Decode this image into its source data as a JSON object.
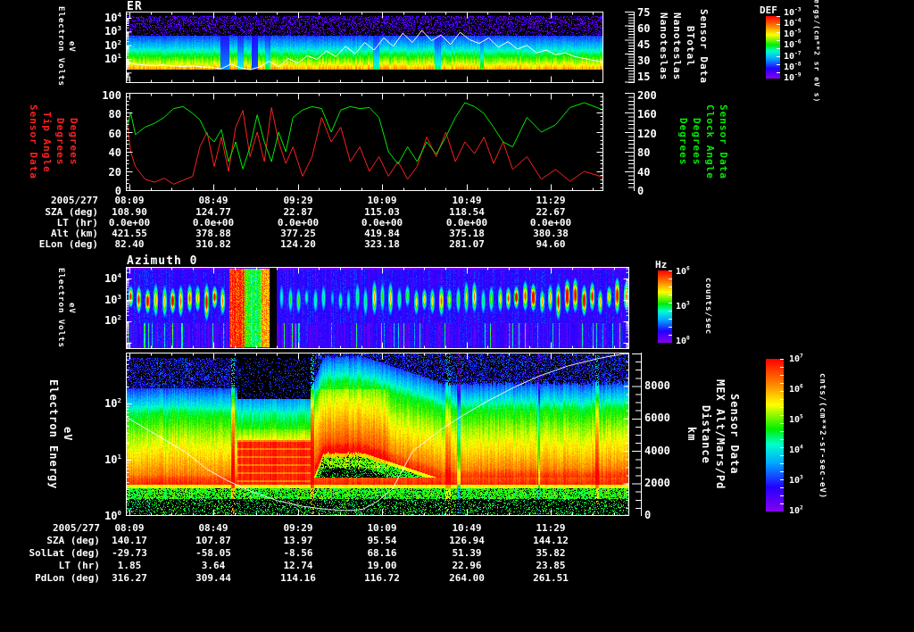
{
  "colors": {
    "background": "#000000",
    "axis": "#ffffff",
    "tip_series": "#ff2020",
    "clock_series": "#00ee00",
    "overlay_line": "#ffffff",
    "palette": [
      {
        "t": 0.0,
        "c": "#8800ee"
      },
      {
        "t": 0.16,
        "c": "#2200ff"
      },
      {
        "t": 0.32,
        "c": "#00aaff"
      },
      {
        "t": 0.44,
        "c": "#00ffcc"
      },
      {
        "t": 0.54,
        "c": "#00ee00"
      },
      {
        "t": 0.7,
        "c": "#ffff00"
      },
      {
        "t": 0.83,
        "c": "#ff8800"
      },
      {
        "t": 1.0,
        "c": "#ff0000"
      }
    ]
  },
  "er": {
    "title": "ER",
    "ylabel_lines": [
      "Electron Volts",
      "eV"
    ],
    "yticks": [
      "10^4",
      "10^3",
      "10^2",
      "10^1"
    ],
    "right_ticks": [
      "75",
      "60",
      "45",
      "30",
      "15"
    ],
    "right_label_lines": [
      "Sensor Data",
      "BTotal",
      "Nanoteslas",
      "Nanoteslas"
    ],
    "colorbar": {
      "title": "DEF",
      "ticks": [
        "10^-3",
        "10^-4",
        "10^-5",
        "10^-6",
        "10^-7",
        "10^-8",
        "10^-9"
      ],
      "units": "ergs/(cm**2 sr eV s)"
    }
  },
  "angles": {
    "left_label_lines": [
      "Sensor Data",
      "Tip Angle",
      "Degrees",
      "Degrees"
    ],
    "left_ticks": [
      "100",
      "80",
      "60",
      "40",
      "20",
      "0"
    ],
    "right_ticks": [
      "200",
      "160",
      "120",
      "80",
      "40",
      "0"
    ],
    "right_label_lines": [
      "Sensor Data",
      "Clock Angle",
      "Degrees",
      "Degrees"
    ]
  },
  "table1": {
    "rows": [
      {
        "label": "2005/277",
        "values": [
          "08:09",
          "08:49",
          "09:29",
          "10:09",
          "10:49",
          "11:29"
        ]
      },
      {
        "label": "SZA (deg)",
        "values": [
          "108.90",
          "124.77",
          "22.87",
          "115.03",
          "118.54",
          "22.67"
        ]
      },
      {
        "label": "LT (hr)",
        "values": [
          "0.0e+00",
          "0.0e+00",
          "0.0e+00",
          "0.0e+00",
          "0.0e+00",
          "0.0e+00"
        ]
      },
      {
        "label": "Alt (km)",
        "values": [
          "421.55",
          "378.88",
          "377.25",
          "419.84",
          "375.18",
          "380.38"
        ]
      },
      {
        "label": "ELon (deg)",
        "values": [
          "82.40",
          "310.82",
          "124.20",
          "323.18",
          "281.07",
          "94.60"
        ]
      }
    ]
  },
  "azimuth": {
    "title": "Azimuth 0",
    "ylabel_lines": [
      "Electron Volts",
      "eV"
    ],
    "yticks": [
      "10^4",
      "10^3",
      "10^2"
    ],
    "colorbar": {
      "title": "Hz",
      "ticks": [
        "10^6",
        "10^3",
        "10^0"
      ],
      "units": "counts/sec"
    }
  },
  "els": {
    "ylabel_lines": [
      "Electron Energy",
      "eV"
    ],
    "yticks": [
      "10^2",
      "10^1",
      "10^0"
    ],
    "right_ticks": [
      "8000",
      "6000",
      "4000",
      "2000",
      "0"
    ],
    "right_label_lines": [
      "Sensor Data",
      "MEX Alt/Mars/Pd",
      "Distance",
      "km"
    ],
    "colorbar": {
      "ticks": [
        "10^7",
        "10^6",
        "10^5",
        "10^4",
        "10^3",
        "10^2"
      ],
      "units": "cnts/(cm**2-sr-sec-eV)"
    }
  },
  "table2": {
    "rows": [
      {
        "label": "2005/277",
        "values": [
          "08:09",
          "08:49",
          "09:29",
          "10:09",
          "10:49",
          "11:29"
        ]
      },
      {
        "label": "SZA (deg)",
        "values": [
          "140.17",
          "107.87",
          "13.97",
          "95.54",
          "126.94",
          "144.12"
        ]
      },
      {
        "label": "SolLat (deg)",
        "values": [
          "-29.73",
          "-58.05",
          "-8.56",
          "68.16",
          "51.39",
          "35.82"
        ]
      },
      {
        "label": "LT (hr)",
        "values": [
          "1.85",
          "3.64",
          "12.74",
          "19.00",
          "22.96",
          "23.85"
        ]
      },
      {
        "label": "PdLon (deg)",
        "values": [
          "316.27",
          "309.44",
          "114.16",
          "116.72",
          "264.00",
          "261.51"
        ]
      }
    ]
  },
  "chart_data": [
    {
      "name": "er_energy_flux_spectrogram",
      "type": "heatmap",
      "title": "ER",
      "y_axis": {
        "label": "Electron Volts eV",
        "scale": "log",
        "ticks": [
          10000,
          1000,
          100,
          10
        ]
      },
      "x_tick_labels": [
        "08:09",
        "08:49",
        "09:29",
        "10:09",
        "10:49",
        "11:29"
      ],
      "colorbar": {
        "title": "DEF",
        "units": "ergs/(cm**2 sr eV s)",
        "range": [
          "1e-9",
          "1e-3"
        ]
      },
      "overlay_series": {
        "name": "BTotal (Nanoteslas)",
        "range": [
          15,
          75
        ],
        "x": [
          0,
          0.02,
          0.04,
          0.06,
          0.08,
          0.1,
          0.12,
          0.14,
          0.16,
          0.18,
          0.2,
          0.22,
          0.24,
          0.26,
          0.28,
          0.3,
          0.32,
          0.34,
          0.36,
          0.38,
          0.4,
          0.42,
          0.44,
          0.46,
          0.48,
          0.5,
          0.52,
          0.54,
          0.56,
          0.58,
          0.6,
          0.62,
          0.64,
          0.66,
          0.68,
          0.7,
          0.72,
          0.74,
          0.76,
          0.78,
          0.8,
          0.82,
          0.84,
          0.86,
          0.88,
          0.9,
          0.92,
          0.94,
          0.96,
          0.98,
          1.0
        ],
        "y": [
          21,
          19,
          18,
          17.5,
          18,
          17,
          16.5,
          17,
          16,
          15.5,
          14,
          19,
          15,
          13,
          16,
          22,
          16,
          25,
          20,
          28,
          24,
          33,
          27,
          38,
          30,
          42,
          34,
          47,
          38,
          52,
          42,
          55,
          44,
          50,
          40,
          53,
          45,
          41,
          47,
          37,
          43,
          35,
          39,
          31,
          34,
          29,
          31,
          27,
          25,
          23,
          21
        ]
      },
      "paint": {
        "dropouts": [
          [
            0.198,
            0.215,
            0.8
          ],
          [
            0.233,
            0.246,
            0.55
          ],
          [
            0.262,
            0.276,
            0.9
          ],
          [
            0.29,
            0.301,
            0.45
          ],
          [
            0.517,
            0.53,
            0.5
          ],
          [
            0.645,
            0.659,
            0.5
          ],
          [
            0.742,
            0.749,
            0.35
          ]
        ]
      }
    },
    {
      "name": "mag_angles",
      "type": "line",
      "series": [
        {
          "name": "Tip Angle (Degrees)",
          "ylim": [
            0,
            100
          ],
          "x": [
            0,
            0.01,
            0.02,
            0.04,
            0.06,
            0.08,
            0.1,
            0.12,
            0.14,
            0.155,
            0.17,
            0.185,
            0.2,
            0.215,
            0.23,
            0.245,
            0.26,
            0.275,
            0.29,
            0.305,
            0.32,
            0.335,
            0.35,
            0.37,
            0.39,
            0.41,
            0.43,
            0.45,
            0.47,
            0.49,
            0.51,
            0.53,
            0.55,
            0.57,
            0.59,
            0.61,
            0.63,
            0.65,
            0.67,
            0.69,
            0.71,
            0.73,
            0.75,
            0.77,
            0.79,
            0.81,
            0.84,
            0.87,
            0.9,
            0.93,
            0.96,
            1
          ],
          "y": [
            82,
            40,
            25,
            12,
            9,
            13,
            7,
            11,
            15,
            45,
            60,
            25,
            55,
            20,
            65,
            82,
            35,
            60,
            30,
            85,
            50,
            28,
            45,
            15,
            35,
            75,
            50,
            65,
            30,
            45,
            20,
            35,
            15,
            30,
            12,
            25,
            55,
            35,
            60,
            30,
            50,
            38,
            55,
            28,
            50,
            22,
            35,
            12,
            22,
            10,
            20,
            14
          ]
        },
        {
          "name": "Clock Angle (Degrees)",
          "ylim": [
            0,
            200
          ],
          "x": [
            0,
            0.01,
            0.02,
            0.04,
            0.06,
            0.08,
            0.1,
            0.12,
            0.14,
            0.155,
            0.17,
            0.185,
            0.2,
            0.215,
            0.23,
            0.245,
            0.26,
            0.275,
            0.29,
            0.305,
            0.32,
            0.335,
            0.35,
            0.37,
            0.39,
            0.41,
            0.43,
            0.45,
            0.47,
            0.49,
            0.51,
            0.53,
            0.55,
            0.57,
            0.59,
            0.61,
            0.63,
            0.65,
            0.67,
            0.69,
            0.71,
            0.73,
            0.75,
            0.77,
            0.79,
            0.81,
            0.84,
            0.87,
            0.9,
            0.93,
            0.96,
            1
          ],
          "y": [
            120,
            160,
            115,
            130,
            138,
            150,
            168,
            172,
            158,
            145,
            115,
            100,
            125,
            60,
            100,
            45,
            90,
            155,
            100,
            60,
            120,
            80,
            150,
            165,
            172,
            168,
            120,
            165,
            172,
            168,
            170,
            150,
            80,
            55,
            90,
            60,
            100,
            75,
            110,
            150,
            180,
            172,
            158,
            130,
            100,
            90,
            150,
            120,
            135,
            170,
            180,
            165
          ]
        }
      ]
    },
    {
      "name": "els_azimuth0_count_rate_spectrogram",
      "type": "heatmap",
      "title": "Azimuth 0",
      "y_axis": {
        "label": "Electron Volts eV",
        "scale": "log",
        "ticks": [
          10000,
          1000,
          100
        ]
      },
      "colorbar": {
        "title": "Hz",
        "units": "counts/sec",
        "range": [
          "1e0",
          "1e6"
        ]
      },
      "paint": {
        "regions": [
          {
            "x0": 4,
            "x1": 114,
            "amp": 0.95
          },
          {
            "x0": 172,
            "x1": 252,
            "amp": 0.5
          },
          {
            "x0": 252,
            "x1": 412,
            "amp": 0.75
          },
          {
            "x0": 412,
            "x1": 560,
            "amp": 1.05
          }
        ],
        "saturated": [
          {
            "x0": 116,
            "x1": 133,
            "vals": [
              1,
              0.96,
              0.88,
              1,
              0.93,
              1
            ]
          },
          {
            "x0": 133,
            "x1": 152,
            "vals": [
              0.58,
              0.52,
              0.62,
              0.48,
              0.56
            ]
          },
          {
            "x0": 152,
            "x1": 161,
            "vals": [
              0.8,
              0.86,
              0.78,
              0.83
            ]
          }
        ],
        "gap": [
          161,
          169
        ]
      }
    },
    {
      "name": "els_energy_flux_spectrogram",
      "type": "heatmap",
      "y_axis": {
        "label": "Electron Energy eV",
        "scale": "log",
        "ticks": [
          100,
          10,
          1
        ]
      },
      "x_tick_labels": [
        "08:09",
        "08:49",
        "09:29",
        "10:09",
        "10:49",
        "11:29"
      ],
      "colorbar": {
        "units": "cnts/(cm**2-sr-sec-eV)",
        "range": [
          "1e2",
          "1e7"
        ]
      },
      "altitude_overlay": {
        "name": "MEX Alt/Mars/Pd Distance (km)",
        "range_km": [
          0,
          10000
        ],
        "x": [
          0,
          0.06,
          0.12,
          0.16,
          0.2,
          0.25,
          0.3,
          0.35,
          0.4,
          0.44,
          0.47,
          0.5,
          0.53,
          0.57,
          0.6,
          0.63,
          0.67,
          0.72,
          0.77,
          0.82,
          0.88,
          0.94,
          1
        ],
        "km": [
          6100,
          5000,
          3900,
          2900,
          2200,
          1500,
          950,
          600,
          400,
          330,
          400,
          900,
          1700,
          4000,
          4700,
          5400,
          6200,
          7100,
          7900,
          8600,
          9250,
          9700,
          10050
        ]
      },
      "paint": {
        "iono": [
          0.22,
          0.367
        ],
        "hump": {
          "x0": 0.367,
          "xpeak": 0.392,
          "xhold": 0.47,
          "xend": 0.62,
          "top_base": 68,
          "top_peak": 32,
          "top_end": 60,
          "top_post": 62
        },
        "streaks": [
          {
            "f": 0.212,
            "w": 2,
            "b": 0.22
          },
          {
            "f": 0.369,
            "w": 2,
            "b": 0.2
          },
          {
            "f": 0.64,
            "w": 3,
            "b": 0.12
          },
          {
            "f": 0.935,
            "w": 2,
            "b": 0.14
          }
        ],
        "darks": [
          {
            "f": 0.66,
            "w": 2,
            "b": -0.22
          },
          {
            "f": 0.82,
            "w": 1,
            "b": -0.18
          }
        ]
      }
    }
  ]
}
